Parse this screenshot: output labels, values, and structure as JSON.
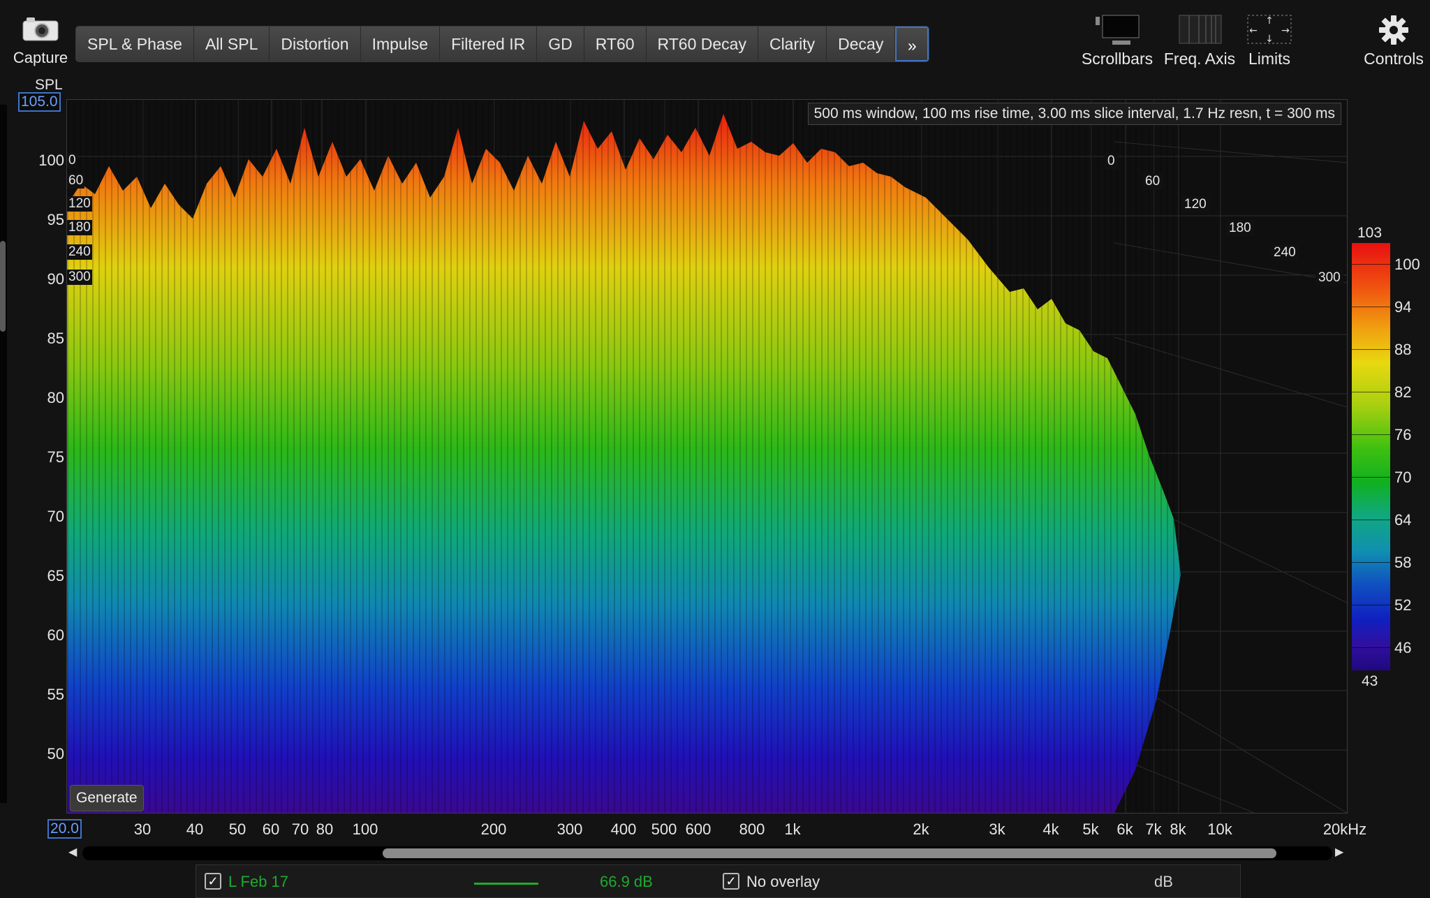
{
  "toolbar": {
    "capture_label": "Capture",
    "tabs": [
      "SPL & Phase",
      "All SPL",
      "Distortion",
      "Impulse",
      "Filtered IR",
      "GD",
      "RT60",
      "RT60 Decay",
      "Clarity",
      "Decay"
    ],
    "more_label": "»",
    "scrollbars_label": "Scrollbars",
    "freq_axis_label": "Freq. Axis",
    "limits_label": "Limits",
    "controls_label": "Controls"
  },
  "plot": {
    "info": "500 ms window, 100 ms rise time, 3.00 ms slice interval, 1.7 Hz resn, t = 300 ms",
    "generate_label": "Generate",
    "y_axis_title": "SPL",
    "y_top_value": "105.0",
    "y_ticks": [
      "100",
      "95",
      "90",
      "85",
      "80",
      "75",
      "70",
      "65",
      "60",
      "55",
      "50"
    ],
    "x_start_value": "20.0",
    "x_ticks": [
      "30",
      "40",
      "50",
      "60",
      "70",
      "80",
      "100",
      "200",
      "300",
      "400",
      "500",
      "600",
      "800",
      "1k",
      "2k",
      "3k",
      "4k",
      "5k",
      "6k",
      "7k",
      "8k",
      "10k",
      "20kHz"
    ],
    "slice_labels_left": [
      "0",
      "60",
      "120",
      "180",
      "240",
      "300"
    ],
    "slice_labels_right": [
      "0",
      "60",
      "120",
      "180",
      "240",
      "300"
    ]
  },
  "colorbar": {
    "max_label": "103",
    "min_label": "43",
    "ticks": [
      "100",
      "94",
      "88",
      "82",
      "76",
      "70",
      "64",
      "58",
      "52",
      "46"
    ]
  },
  "status": {
    "measurement_name": "L Feb 17",
    "measurement_color": "#1faa2f",
    "measurement_value": "66.9 dB",
    "overlay_label": "No overlay",
    "unit_label": "dB"
  }
}
